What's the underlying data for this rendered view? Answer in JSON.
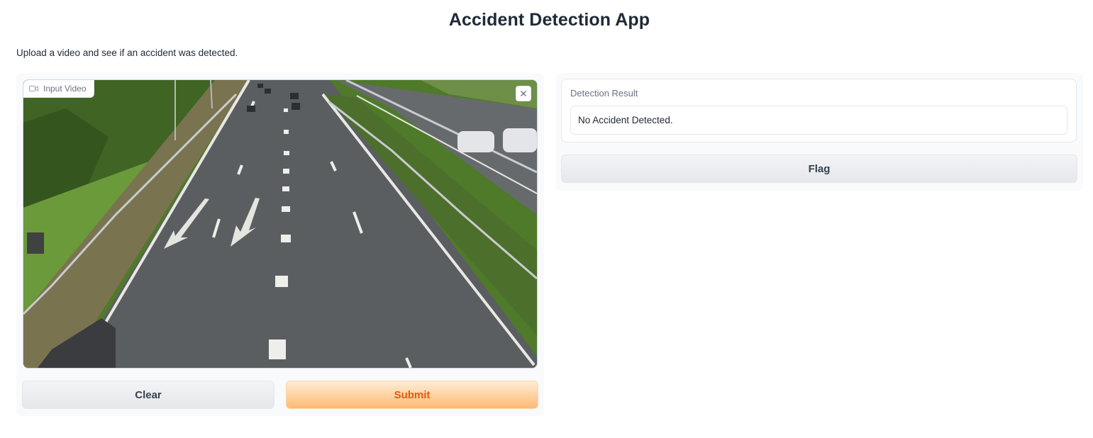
{
  "app": {
    "title": "Accident Detection App",
    "description": "Upload a video and see if an accident was detected."
  },
  "input": {
    "video_label": "Input Video",
    "video_icon": "video-camera-icon",
    "close_icon": "close-icon",
    "clear_label": "Clear",
    "submit_label": "Submit"
  },
  "output": {
    "result_label": "Detection Result",
    "result_value": "No Accident Detected.",
    "flag_label": "Flag"
  },
  "colors": {
    "submit_text": "#ea580c",
    "submit_bg": "#fdba74",
    "panel_bg": "#f9fafb"
  }
}
